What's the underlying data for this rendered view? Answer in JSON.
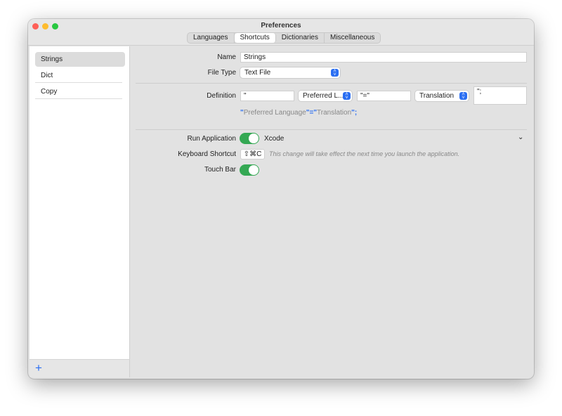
{
  "window": {
    "title": "Preferences"
  },
  "tabs": [
    {
      "label": "Languages"
    },
    {
      "label": "Shortcuts"
    },
    {
      "label": "Dictionaries"
    },
    {
      "label": "Miscellaneous"
    }
  ],
  "sidebar": {
    "items": [
      {
        "label": "Strings"
      },
      {
        "label": "Dict"
      },
      {
        "label": "Copy"
      }
    ],
    "add_label": "+"
  },
  "form": {
    "name_label": "Name",
    "name_value": "Strings",
    "filetype_label": "File Type",
    "filetype_value": "Text File",
    "definition_label": "Definition",
    "def_prefix": "\"",
    "def_language": "Preferred L...",
    "def_separator": "\"=\"",
    "def_translation": "Translation",
    "def_suffix": "\";",
    "preview": {
      "q1": "\"",
      "lang": "Preferred Language",
      "sep": "\"=\"",
      "trans": "Translation",
      "end": "\";"
    },
    "run_app_label": "Run Application",
    "run_app_on": true,
    "run_app_value": "Xcode",
    "shortcut_label": "Keyboard Shortcut",
    "shortcut_value": "⇧⌘C",
    "shortcut_note": "This change will take effect the next time you launch the application.",
    "touchbar_label": "Touch Bar",
    "touchbar_on": true
  },
  "colors": {
    "accent": "#2a6ef2",
    "toggle": "#34a853"
  }
}
